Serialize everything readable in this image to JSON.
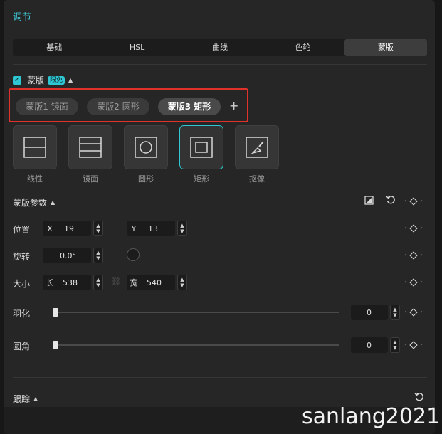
{
  "panel": {
    "title": "调节"
  },
  "tabs": [
    {
      "label": "基础",
      "active": false
    },
    {
      "label": "HSL",
      "active": false
    },
    {
      "label": "曲线",
      "active": false
    },
    {
      "label": "色轮",
      "active": false
    },
    {
      "label": "蒙版",
      "active": true
    }
  ],
  "mask_section": {
    "label": "蒙版",
    "badge": "限免",
    "enabled": true
  },
  "mask_chips": [
    {
      "label": "蒙版1 镜面",
      "active": false
    },
    {
      "label": "蒙版2 圆形",
      "active": false
    },
    {
      "label": "蒙版3 矩形",
      "active": true
    }
  ],
  "add_mask_symbol": "+",
  "shapes": [
    {
      "label": "线性",
      "icon": "linear-mask-icon",
      "active": false
    },
    {
      "label": "镜面",
      "icon": "mirror-mask-icon",
      "active": false
    },
    {
      "label": "圆形",
      "icon": "circle-mask-icon",
      "active": false
    },
    {
      "label": "矩形",
      "icon": "rectangle-mask-icon",
      "active": true
    },
    {
      "label": "抠像",
      "icon": "brush-cutout-icon",
      "active": false
    }
  ],
  "params": {
    "title": "蒙版参数",
    "position": {
      "label": "位置",
      "x_key": "X",
      "x_value": "19",
      "y_key": "Y",
      "y_value": "13"
    },
    "rotation": {
      "label": "旋转",
      "value": "0.0°"
    },
    "size": {
      "label": "大小",
      "w_key": "长",
      "w_value": "538",
      "h_key": "宽",
      "h_value": "540"
    },
    "feather": {
      "label": "羽化",
      "value": "0",
      "level": 0
    },
    "corner": {
      "label": "圆角",
      "value": "0",
      "level": 0
    }
  },
  "tracking": {
    "label": "跟踪"
  },
  "watermark": "sanlang2021",
  "colors": {
    "accent": "#2ec7d3",
    "highlight_border": "#e0312b"
  }
}
